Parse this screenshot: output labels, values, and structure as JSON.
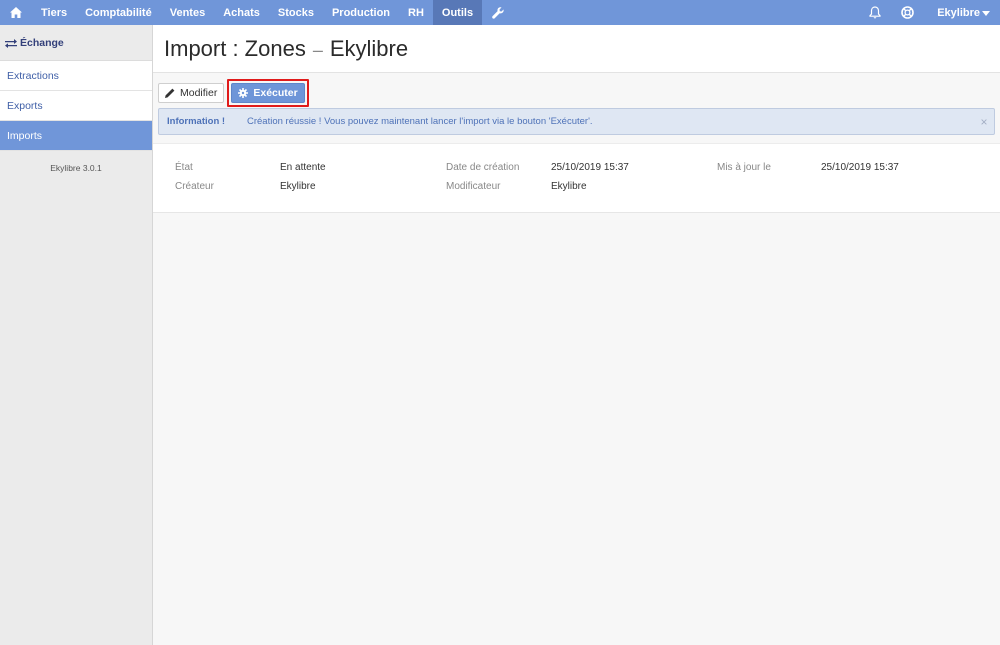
{
  "nav": {
    "home_icon": "home-icon",
    "items": [
      {
        "label": "Tiers"
      },
      {
        "label": "Comptabilité"
      },
      {
        "label": "Ventes"
      },
      {
        "label": "Achats"
      },
      {
        "label": "Stocks"
      },
      {
        "label": "Production"
      },
      {
        "label": "RH"
      },
      {
        "label": "Outils",
        "active": true
      }
    ],
    "tools_icon": "wrench-icon",
    "bell_icon": "bell-icon",
    "help_icon": "lifebuoy-icon",
    "user": "Ekylibre"
  },
  "sidebar": {
    "header": "Échange",
    "header_icon": "exchange-icon",
    "items": [
      {
        "label": "Extractions"
      },
      {
        "label": "Exports"
      },
      {
        "label": "Imports",
        "active": true
      }
    ],
    "version": "Ekylibre 3.0.1"
  },
  "page": {
    "title_main": "Import : Zones",
    "title_sep": "–",
    "title_sub": "Ekylibre"
  },
  "toolbar": {
    "edit_label": "Modifier",
    "edit_icon": "pencil-icon",
    "run_label": "Exécuter",
    "run_icon": "gear-icon"
  },
  "alert": {
    "title": "Information !",
    "message": "Création réussie ! Vous pouvez maintenant lancer l'import via le bouton 'Exécuter'.",
    "close": "×"
  },
  "details": {
    "state_label": "État",
    "state_value": "En attente",
    "creator_label": "Créateur",
    "creator_value": "Ekylibre",
    "created_label": "Date de création",
    "created_value": "25/10/2019 15:37",
    "modifier_label": "Modificateur",
    "modifier_value": "Ekylibre",
    "updated_label": "Mis à jour le",
    "updated_value": "25/10/2019 15:37"
  },
  "colors": {
    "nav": "#7096d9",
    "nav_active": "#5878b7",
    "primary": "#6e95d8",
    "highlight": "#e01b1b",
    "alert_bg": "#dfe7f3"
  }
}
